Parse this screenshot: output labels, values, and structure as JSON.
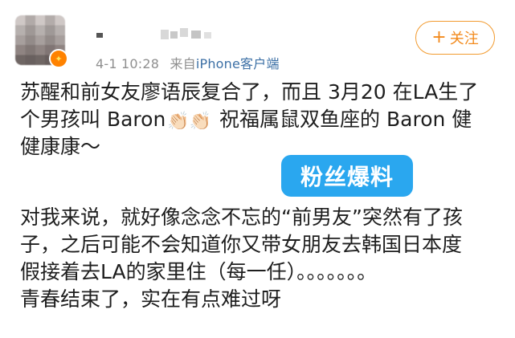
{
  "post": {
    "meta_time": "4-1 10:28",
    "meta_source_prefix": "来自",
    "meta_source_app": "iPhone客户端",
    "follow_label": "关注",
    "paragraph1": {
      "line1": "苏醒和前女友廖语辰复合了，而且 3月20 在LA生了",
      "line2_before": "个男孩叫 Baron",
      "line2_emoji": "👏🏻👏🏻",
      "line2_after": " 祝福属鼠双鱼座的 Baron 健",
      "line3": "健康康～"
    },
    "paragraph2": {
      "line1": "对我来说，就好像念念不忘的“前男友”突然有了孩",
      "line2": "子，之后可能不会知道你又带女朋友去韩国日本度",
      "line3": "假接着去LA的家里住（每一任）。。。。。。。",
      "line4": "青春结束了，实在有点难过呀"
    }
  },
  "overlay": {
    "badge_text": "粉丝爆料"
  },
  "icons": {
    "avatar_badge": "v-badge-icon",
    "follow_plus": "plus-icon"
  },
  "colors": {
    "follow": "#f28a1c",
    "link": "#3b6fa5",
    "badge_bg": "#2aa7ef",
    "meta": "#8f8f8f"
  }
}
